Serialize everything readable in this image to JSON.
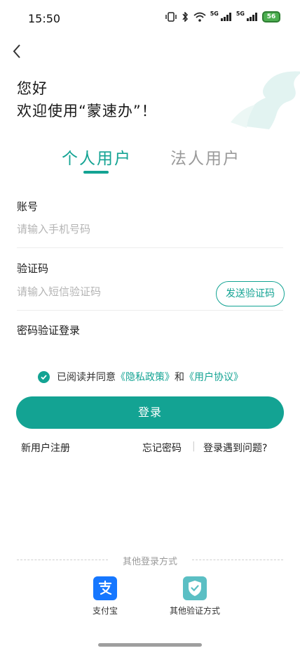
{
  "status_bar": {
    "time": "15:50",
    "network_1": "5G",
    "network_2": "5G",
    "battery": "56"
  },
  "greeting": {
    "line1": "您好",
    "line2": "欢迎使用“蒙速办”！"
  },
  "tabs": [
    {
      "label": "个人用户",
      "active": true
    },
    {
      "label": "法人用户",
      "active": false
    }
  ],
  "account": {
    "label": "账号",
    "placeholder": "请输入手机号码",
    "value": ""
  },
  "code": {
    "label": "验证码",
    "placeholder": "请输入短信验证码",
    "value": "",
    "send_label": "发送验证码"
  },
  "password_login_label": "密码验证登录",
  "agreement": {
    "prefix": "已阅读并同意",
    "privacy": "《隐私政策》",
    "and": "和",
    "terms": "《用户协议》",
    "checked": true
  },
  "login_label": "登录",
  "links": {
    "register": "新用户注册",
    "forgot": "忘记密码",
    "separator": "|",
    "problem": "登录遇到问题?"
  },
  "other": {
    "title": "其他登录方式",
    "options": [
      {
        "label": "支付宝",
        "icon": "alipay-icon",
        "color": "#1677ff"
      },
      {
        "label": "其他验证方式",
        "icon": "shield-check-icon",
        "color": "#5bbfc4"
      }
    ]
  },
  "colors": {
    "accent": "#13a393"
  }
}
